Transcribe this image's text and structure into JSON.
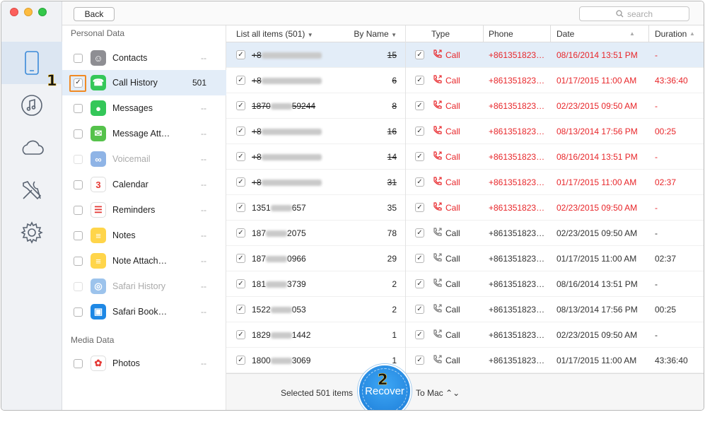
{
  "toolbar": {
    "back_label": "Back",
    "search_placeholder": "search"
  },
  "categories": {
    "personal_label": "Personal Data",
    "media_label": "Media Data",
    "items": [
      {
        "name": "Contacts",
        "count": "--",
        "icon": "contacts-icon",
        "color": "#8e8e93",
        "glyph": "☺",
        "dim": false
      },
      {
        "name": "Call History",
        "count": "501",
        "icon": "phone-icon",
        "color": "#34c759",
        "glyph": "☎",
        "dim": false,
        "checked": true,
        "active": true
      },
      {
        "name": "Messages",
        "count": "--",
        "icon": "messages-icon",
        "color": "#34c759",
        "glyph": "●",
        "dim": false
      },
      {
        "name": "Message Att…",
        "count": "--",
        "icon": "message-attachment-icon",
        "color": "#55c24b",
        "glyph": "✉",
        "dim": false
      },
      {
        "name": "Voicemail",
        "count": "--",
        "icon": "voicemail-icon",
        "color": "#8fb4e6",
        "glyph": "∞",
        "dim": true
      },
      {
        "name": "Calendar",
        "count": "--",
        "icon": "calendar-icon",
        "color": "#ffffff",
        "glyph": "3",
        "dim": false
      },
      {
        "name": "Reminders",
        "count": "--",
        "icon": "reminders-icon",
        "color": "#ffffff",
        "glyph": "☰",
        "dim": false
      },
      {
        "name": "Notes",
        "count": "--",
        "icon": "notes-icon",
        "color": "#ffd54a",
        "glyph": "≡",
        "dim": false
      },
      {
        "name": "Note Attach…",
        "count": "--",
        "icon": "note-attachment-icon",
        "color": "#ffd54a",
        "glyph": "≡",
        "dim": false
      },
      {
        "name": "Safari History",
        "count": "--",
        "icon": "safari-icon",
        "color": "#9cc3ec",
        "glyph": "◎",
        "dim": true
      },
      {
        "name": "Safari Book…",
        "count": "--",
        "icon": "safari-bookmark-icon",
        "color": "#1e88e5",
        "glyph": "▣",
        "dim": false
      },
      {
        "name": "Photos",
        "count": "--",
        "icon": "photos-icon",
        "color": "#ffffff",
        "glyph": "✿",
        "dim": false
      }
    ]
  },
  "list": {
    "header_left": "List all items (501)",
    "header_right": "By Name",
    "rows": [
      {
        "pre": "+8",
        "post": "",
        "count": "15",
        "strike": true,
        "selected": true
      },
      {
        "pre": "+8",
        "post": "",
        "count": "6",
        "strike": true
      },
      {
        "pre": "1870",
        "post": "59244",
        "count": "8",
        "strike": true
      },
      {
        "pre": "+8",
        "post": "",
        "count": "16",
        "strike": true
      },
      {
        "pre": "+8",
        "post": "",
        "count": "14",
        "strike": true
      },
      {
        "pre": "+8",
        "post": "",
        "count": "31",
        "strike": true
      },
      {
        "pre": "1351",
        "post": "657",
        "count": "35",
        "strike": false
      },
      {
        "pre": "187",
        "post": "2075",
        "count": "78",
        "strike": false
      },
      {
        "pre": "187",
        "post": "0966",
        "count": "29",
        "strike": false
      },
      {
        "pre": "181",
        "post": "3739",
        "count": "2",
        "strike": false
      },
      {
        "pre": "1522",
        "post": "053",
        "count": "2",
        "strike": false
      },
      {
        "pre": "1829",
        "post": "1442",
        "count": "1",
        "strike": false
      },
      {
        "pre": "1800",
        "post": "3069",
        "count": "1",
        "strike": false
      }
    ]
  },
  "detail": {
    "headers": {
      "type": "Type",
      "phone": "Phone",
      "date": "Date",
      "duration": "Duration"
    },
    "rows": [
      {
        "type": "Call",
        "phone": "+861351823…",
        "date": "08/16/2014 13:51 PM",
        "duration": "-",
        "missed": true,
        "selected": true
      },
      {
        "type": "Call",
        "phone": "+861351823…",
        "date": "01/17/2015 11:00 AM",
        "duration": "43:36:40",
        "missed": true
      },
      {
        "type": "Call",
        "phone": "+861351823…",
        "date": "02/23/2015 09:50 AM",
        "duration": "-",
        "missed": true
      },
      {
        "type": "Call",
        "phone": "+861351823…",
        "date": "08/13/2014 17:56 PM",
        "duration": "00:25",
        "missed": true
      },
      {
        "type": "Call",
        "phone": "+861351823…",
        "date": "08/16/2014 13:51 PM",
        "duration": "-",
        "missed": true
      },
      {
        "type": "Call",
        "phone": "+861351823…",
        "date": "01/17/2015 11:00 AM",
        "duration": "02:37",
        "missed": true
      },
      {
        "type": "Call",
        "phone": "+861351823…",
        "date": "02/23/2015 09:50 AM",
        "duration": "-",
        "missed": true
      },
      {
        "type": "Call",
        "phone": "+861351823…",
        "date": "02/23/2015 09:50 AM",
        "duration": "-",
        "missed": false
      },
      {
        "type": "Call",
        "phone": "+861351823…",
        "date": "01/17/2015 11:00 AM",
        "duration": "02:37",
        "missed": false
      },
      {
        "type": "Call",
        "phone": "+861351823…",
        "date": "08/16/2014 13:51 PM",
        "duration": "-",
        "missed": false
      },
      {
        "type": "Call",
        "phone": "+861351823…",
        "date": "08/13/2014 17:56 PM",
        "duration": "00:25",
        "missed": false
      },
      {
        "type": "Call",
        "phone": "+861351823…",
        "date": "02/23/2015 09:50 AM",
        "duration": "-",
        "missed": false
      },
      {
        "type": "Call",
        "phone": "+861351823…",
        "date": "01/17/2015 11:00 AM",
        "duration": "43:36:40",
        "missed": false
      }
    ]
  },
  "bottom": {
    "selected_text": "Selected 501 items",
    "recover_label": "Recover",
    "destination": "To Mac ⌃⌄"
  },
  "annotations": {
    "step1": "1",
    "step2": "2"
  },
  "colors": {
    "accent": "#1a7ad6",
    "missed": "#e8262a",
    "highlight": "#f08a24"
  }
}
